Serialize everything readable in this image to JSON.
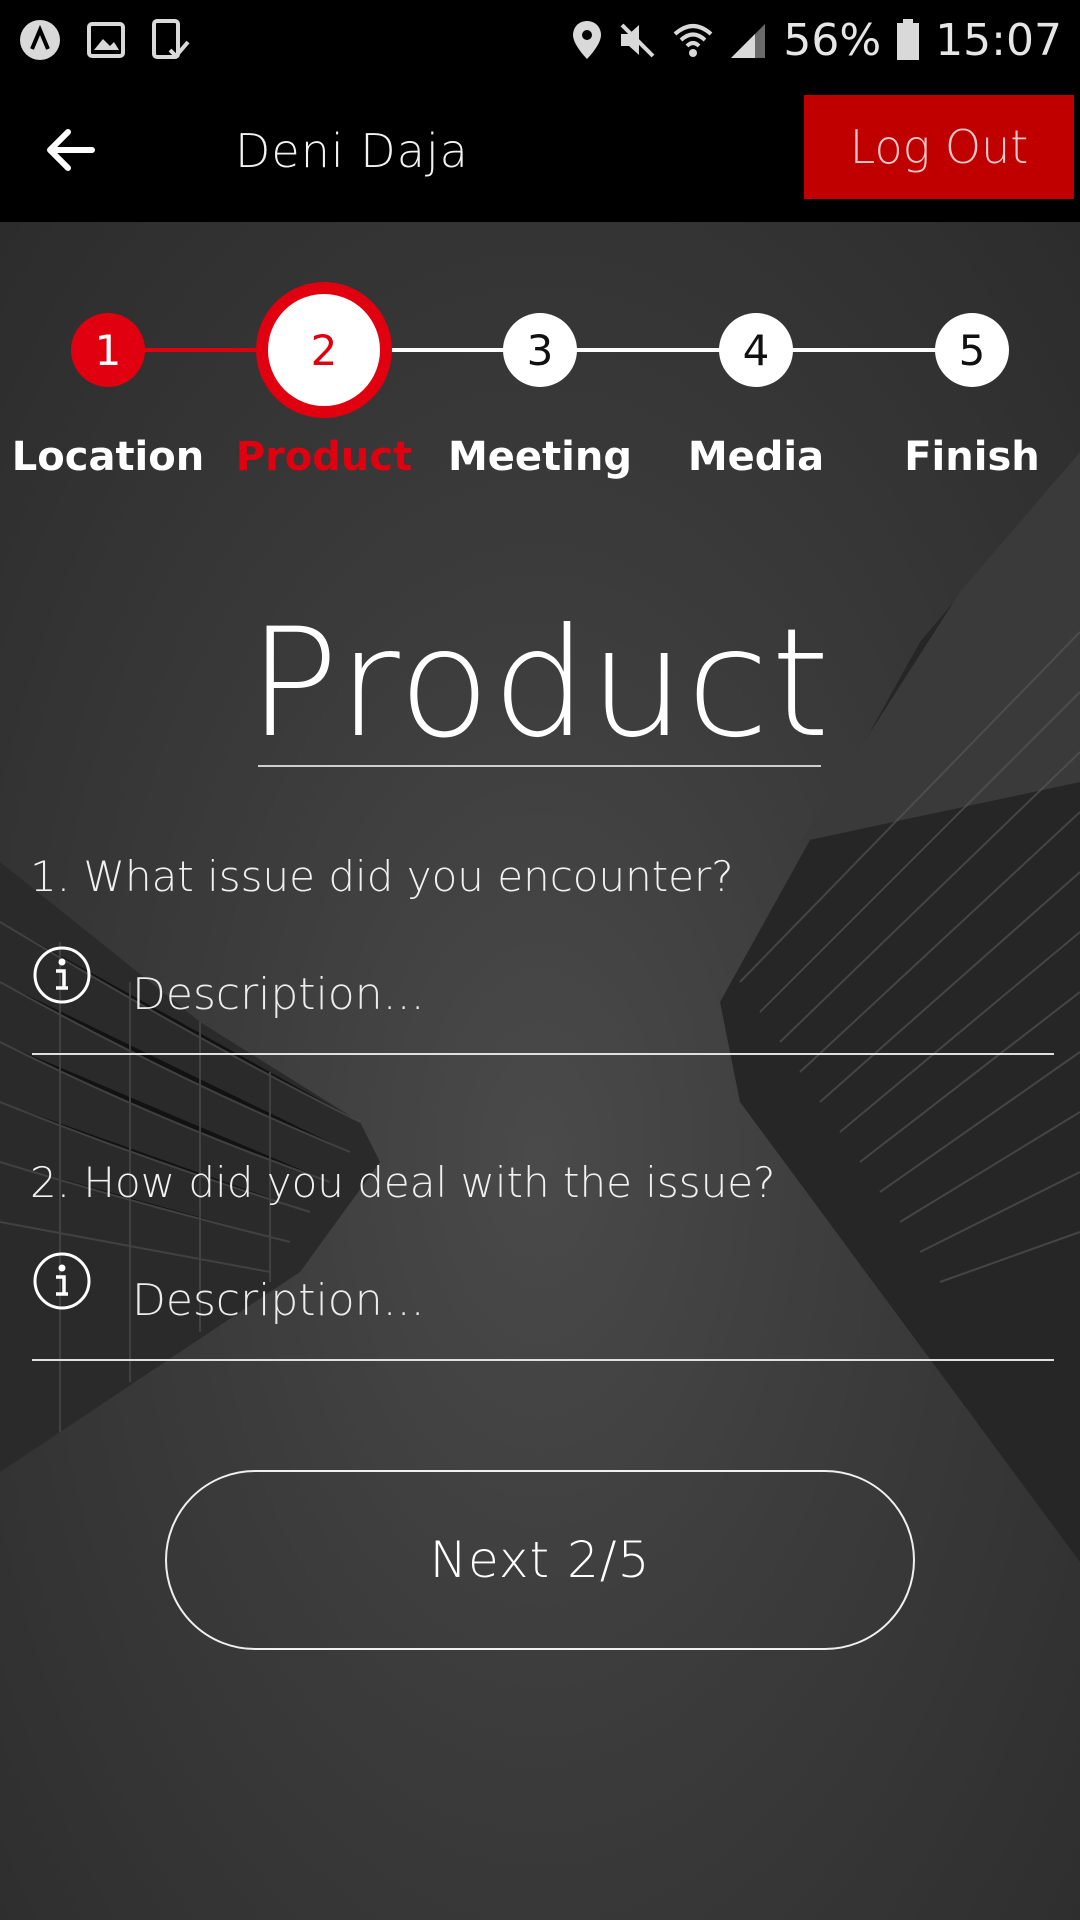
{
  "status_bar": {
    "battery": "56%",
    "time": "15:07",
    "icons_left": [
      "app-a-icon",
      "gallery-icon",
      "device-check-icon"
    ],
    "icons_right": [
      "location-icon",
      "mute-icon",
      "wifi-icon",
      "signal-icon",
      "battery-icon"
    ]
  },
  "app_bar": {
    "user_name": "Deni Daja",
    "logout_label": "Log Out"
  },
  "stepper": {
    "current_step": 2,
    "steps": [
      {
        "number": "1",
        "label": "Location",
        "state": "done"
      },
      {
        "number": "2",
        "label": "Product",
        "state": "active"
      },
      {
        "number": "3",
        "label": "Meeting",
        "state": "pending"
      },
      {
        "number": "4",
        "label": "Media",
        "state": "pending"
      },
      {
        "number": "5",
        "label": "Finish",
        "state": "pending"
      }
    ]
  },
  "main": {
    "title": "Product",
    "questions": [
      {
        "text": "1. What issue did you encounter?",
        "placeholder": "Description...",
        "value": ""
      },
      {
        "text": "2. How did you deal with the issue?",
        "placeholder": "Description...",
        "value": ""
      }
    ],
    "next_label": "Next 2/5"
  },
  "colors": {
    "accent": "#e0000f",
    "logout_bg": "#c00000",
    "bar_bg": "#000000"
  }
}
